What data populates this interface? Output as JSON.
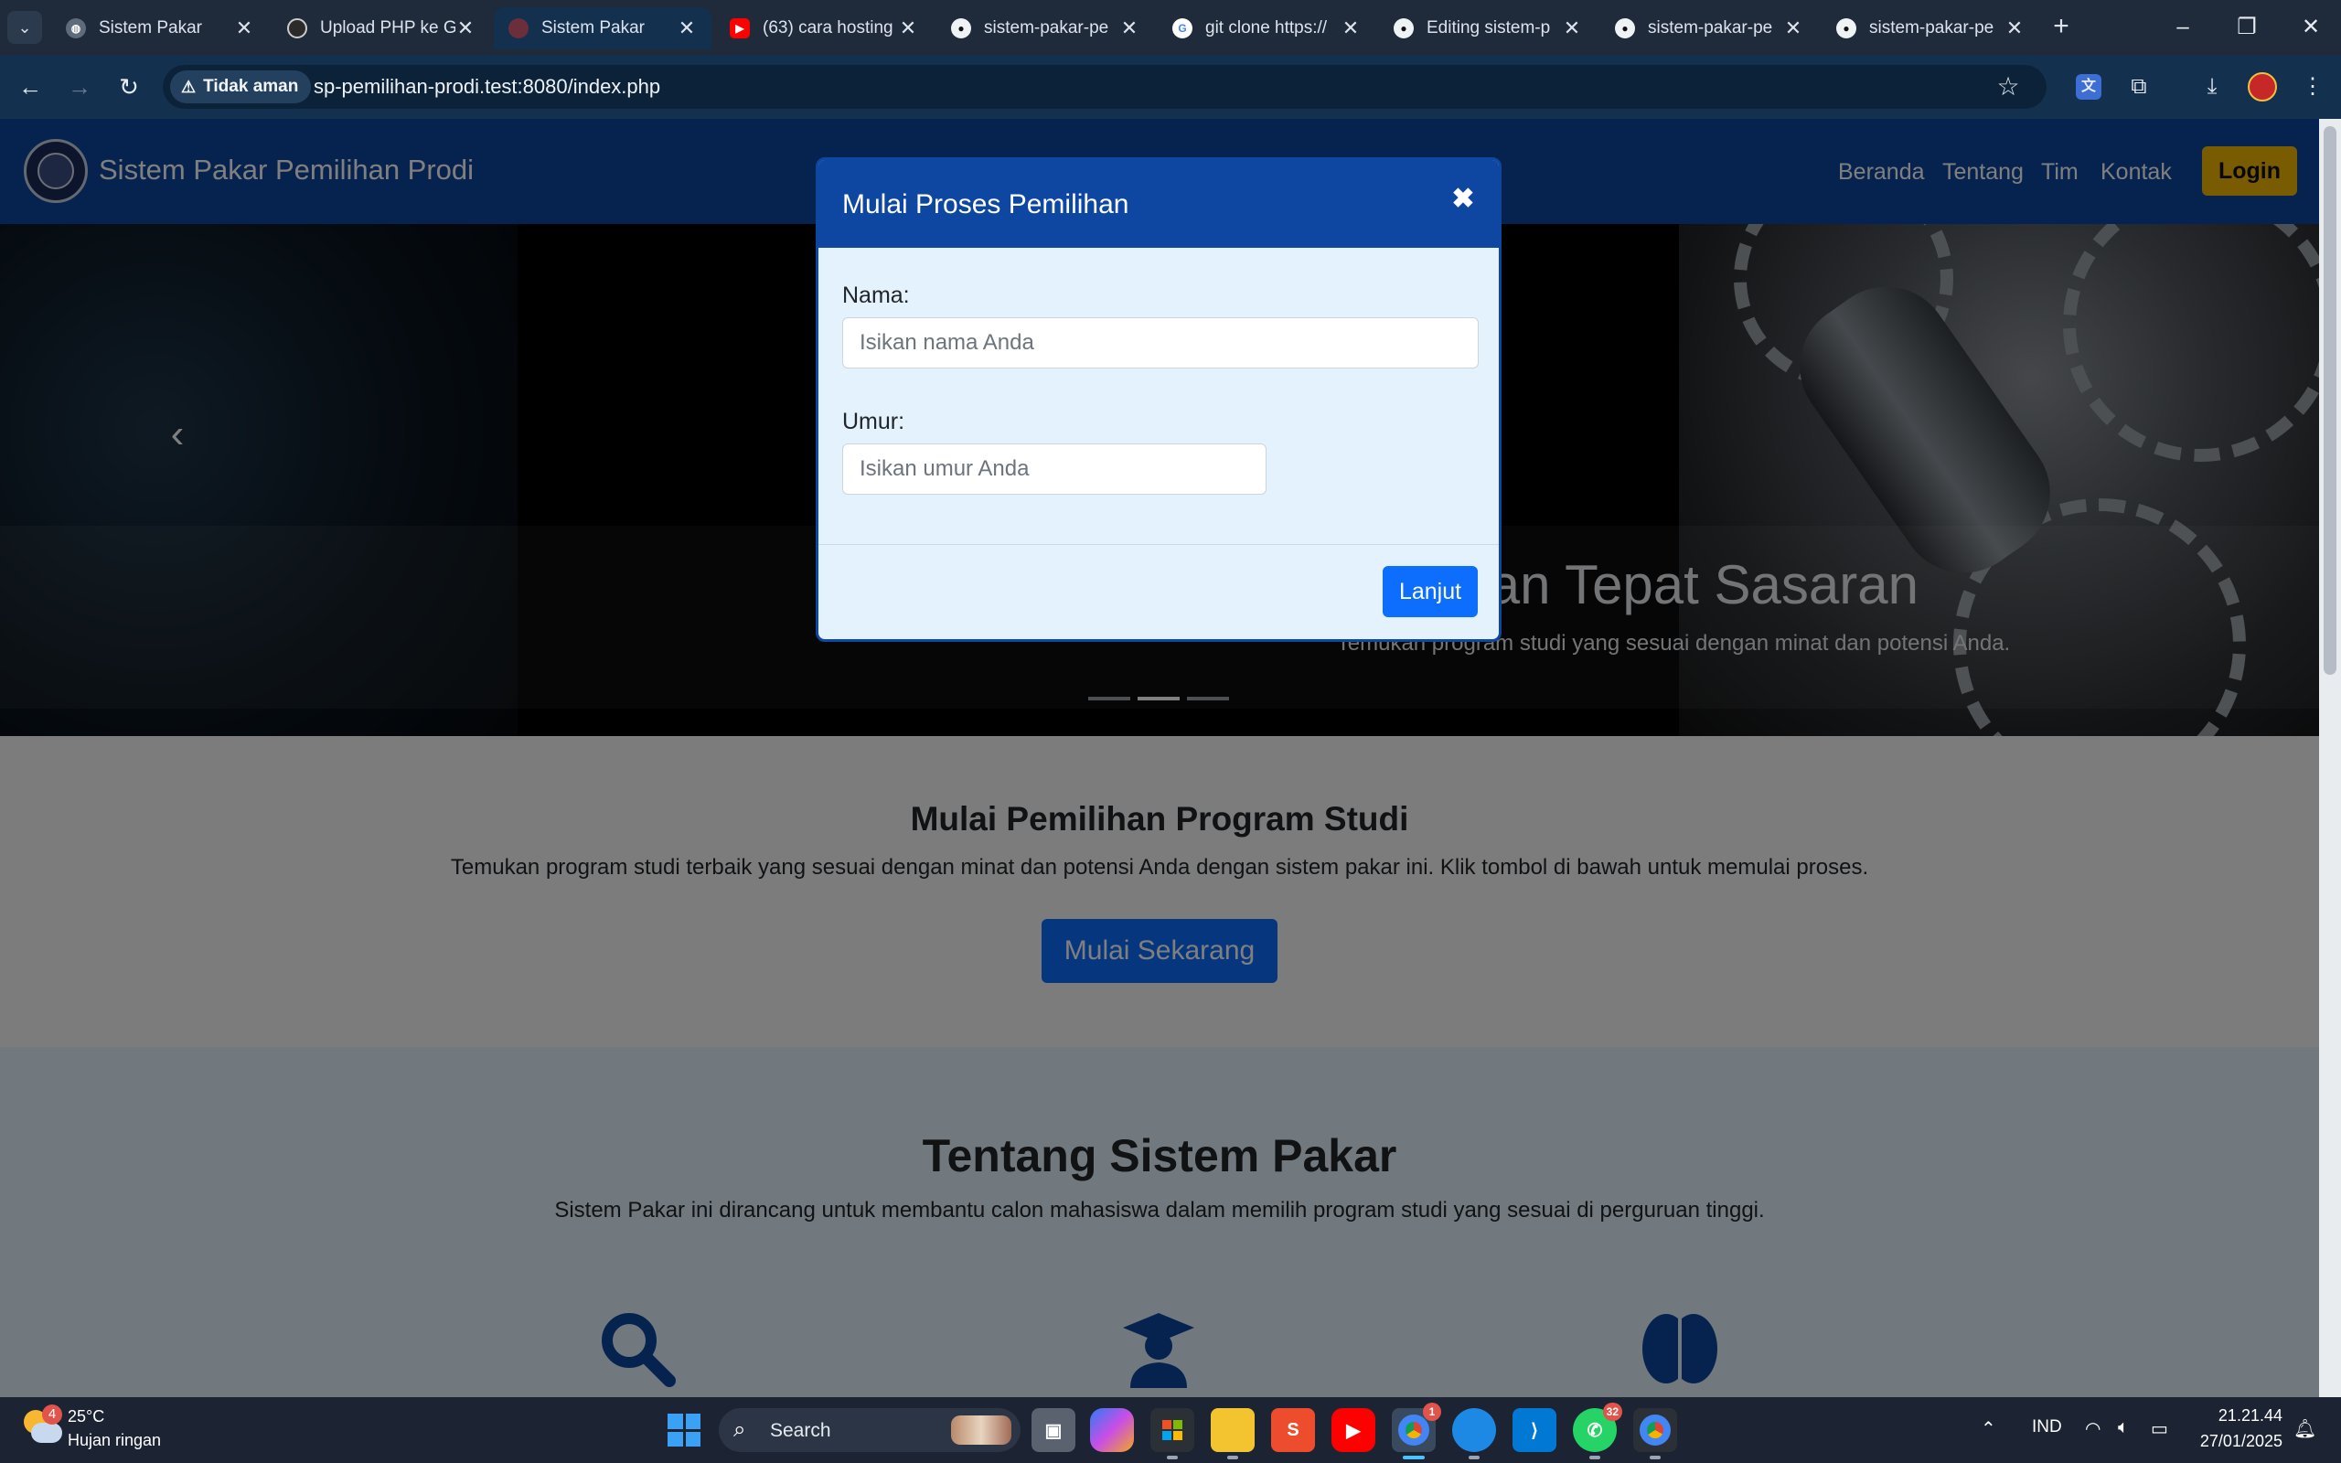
{
  "browser": {
    "tabs": [
      {
        "label": "Sistem Pakar",
        "icon": "globe-icon",
        "color": "#5f6b7a"
      },
      {
        "label": "Upload PHP ke G",
        "icon": "chatgpt-icon",
        "color": "#2b2b2b"
      },
      {
        "label": "Sistem Pakar",
        "icon": "site-icon",
        "color": "#6b2e3a"
      },
      {
        "label": "(63) cara hosting",
        "icon": "youtube-icon",
        "color": "#ff0000"
      },
      {
        "label": "sistem-pakar-pe",
        "icon": "github-icon",
        "color": "#f0f3f6"
      },
      {
        "label": "git clone https://",
        "icon": "google-icon",
        "color": "#4285f4"
      },
      {
        "label": "Editing sistem-p",
        "icon": "github-icon",
        "color": "#f0f3f6"
      },
      {
        "label": "sistem-pakar-pe",
        "icon": "github-icon",
        "color": "#f0f3f6"
      },
      {
        "label": "sistem-pakar-pe",
        "icon": "github-icon",
        "color": "#f0f3f6"
      }
    ],
    "active_tab": 2,
    "security_label": "Tidak aman",
    "url": "sp-pemilihan-prodi.test:8080/index.php"
  },
  "site": {
    "brand": "Sistem Pakar Pemilihan Prodi",
    "nav": [
      "Beranda",
      "Tentang",
      "Tim",
      "Kontak"
    ],
    "login": "Login"
  },
  "hero": {
    "caption_title": "ngan Tepat Sasaran",
    "caption_sub": "Temukan program studi yang sesuai dengan minat dan potensi Anda.",
    "slides": 3,
    "active_slide": 1
  },
  "start": {
    "title": "Mulai Pemilihan Program Studi",
    "desc": "Temukan program studi terbaik yang sesuai dengan minat dan potensi Anda dengan sistem pakar ini. Klik tombol di bawah untuk memulai proses.",
    "button": "Mulai Sekarang"
  },
  "about": {
    "title": "Tentang Sistem Pakar",
    "desc": "Sistem Pakar ini dirancang untuk membantu calon mahasiswa dalam memilih program studi yang sesuai di perguruan tinggi.",
    "icons": [
      "search-icon",
      "graduate-icon",
      "brain-icon"
    ]
  },
  "modal": {
    "title": "Mulai Proses Pemilihan",
    "name_label": "Nama:",
    "name_placeholder": "Isikan nama Anda",
    "age_label": "Umur:",
    "age_placeholder": "Isikan umur Anda",
    "submit": "Lanjut"
  },
  "taskbar": {
    "weather_temp": "25°C",
    "weather_desc": "Hujan ringan",
    "weather_badge": "4",
    "search": "Search",
    "whatsapp_badge": "32",
    "chrome_badge": "1",
    "language": "IND",
    "time": "21.21.44",
    "date": "27/01/2025"
  },
  "colors": {
    "brand_blue": "#0d47a1",
    "primary": "#0d6efd",
    "login_yellow": "#f2b705",
    "modal_bg": "#e3f2fd"
  }
}
